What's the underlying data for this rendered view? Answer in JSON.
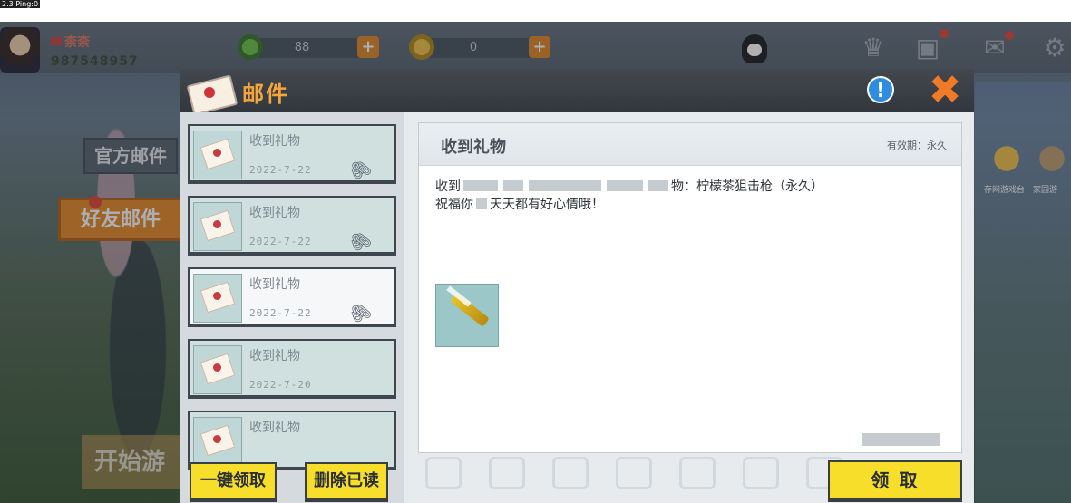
{
  "status": {
    "ping_label": "2.3 Ping:0"
  },
  "player": {
    "name": "柰柰",
    "id": "987548957"
  },
  "currencies": [
    {
      "icon": "green-gem-icon",
      "value": "88"
    },
    {
      "icon": "gold-coin-icon",
      "value": "0"
    }
  ],
  "sidebar": {
    "tabs": [
      {
        "label": "官方邮件"
      },
      {
        "label": "好友邮件"
      }
    ],
    "start_label": "开始游"
  },
  "right_side": {
    "labels": [
      "存网游戏台",
      "家园游"
    ]
  },
  "mail_panel": {
    "title": "邮件",
    "mails": [
      {
        "title": "收到礼物",
        "date": "2022-7-22",
        "has_attachment": true
      },
      {
        "title": "收到礼物",
        "date": "2022-7-22",
        "has_attachment": true
      },
      {
        "title": "收到礼物",
        "date": "2022-7-22",
        "has_attachment": true
      },
      {
        "title": "收到礼物",
        "date": "2022-7-20",
        "has_attachment": false
      },
      {
        "title": "收到礼物",
        "date": "",
        "has_attachment": false
      }
    ],
    "buttons": {
      "claim_all": "一键领取",
      "delete_read": "删除已读",
      "claim": "领 取"
    }
  },
  "mail_detail": {
    "subject": "收到礼物",
    "validity": "有效期：永久",
    "body_line1_start": "收到",
    "body_line1_end": "物：柠檬茶狙击枪（永久）",
    "body_line2_start": "祝福你",
    "body_line2_end": "天天都有好心情哦！",
    "attachment_icon": "lemon-tea-sniper-rifle-icon"
  },
  "colors": {
    "accent_orange": "#f6a53c",
    "button_yellow": "#f7de2a",
    "tab_active": "#e98a2a"
  }
}
